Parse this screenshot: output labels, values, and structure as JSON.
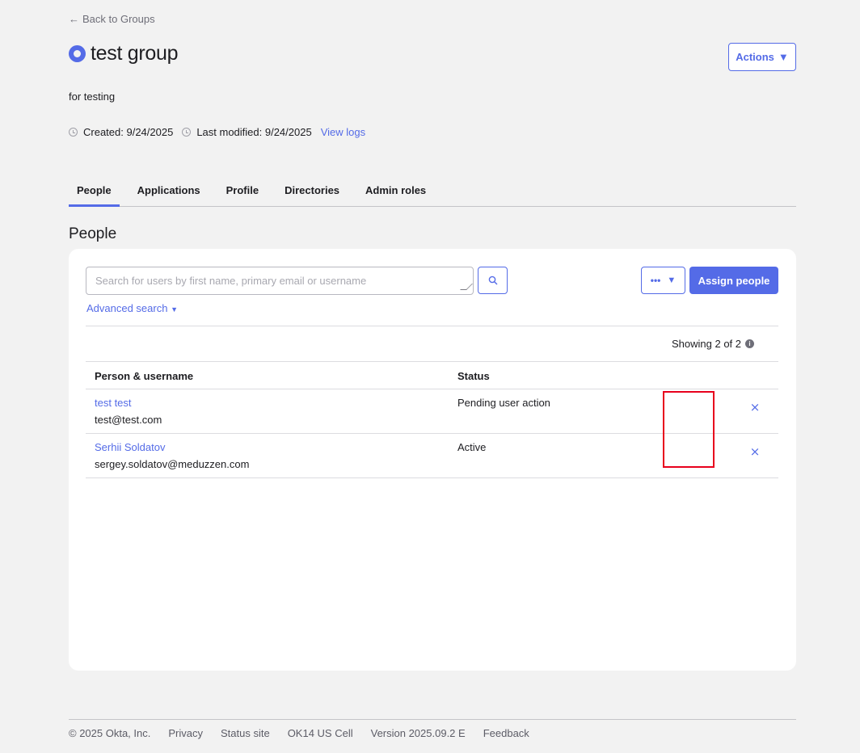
{
  "header": {
    "back_label": "Back to Groups",
    "title": "test group",
    "actions_label": "Actions",
    "description": "for testing",
    "created": "Created: 9/24/2025",
    "modified": "Last modified: 9/24/2025",
    "view_logs": "View logs"
  },
  "tabs": [
    {
      "label": "People",
      "active": true
    },
    {
      "label": "Applications"
    },
    {
      "label": "Profile"
    },
    {
      "label": "Directories"
    },
    {
      "label": "Admin roles"
    }
  ],
  "section_title": "People",
  "search": {
    "placeholder": "Search for users by first name, primary email or username",
    "value": "",
    "advanced_label": "Advanced search"
  },
  "toolbar": {
    "more_label": "•••",
    "assign_label": "Assign people"
  },
  "showing": "Showing 2 of 2",
  "table": {
    "columns": [
      "Person & username",
      "Status"
    ],
    "rows": [
      {
        "name": "test test",
        "email": "test@test.com",
        "status": "Pending user action"
      },
      {
        "name": "Serhii Soldatov",
        "email": "sergey.soldatov@meduzzen.com",
        "status": "Active"
      }
    ],
    "remove_symbol": "×"
  },
  "footer": {
    "copyright": "© 2025 Okta, Inc.",
    "privacy": "Privacy",
    "status_site": "Status site",
    "cell": "OK14 US Cell",
    "version": "Version 2025.09.2 E",
    "feedback": "Feedback"
  },
  "colors": {
    "accent": "#546be7",
    "highlight": "#e8001c",
    "background": "#f2f2f2"
  },
  "icons": {
    "back": "arrow-left-icon",
    "group": "group-ring-icon",
    "caret": "caret-down-icon",
    "clock": "clock-icon",
    "search": "search-icon",
    "info": "info-icon",
    "remove": "close-icon"
  }
}
